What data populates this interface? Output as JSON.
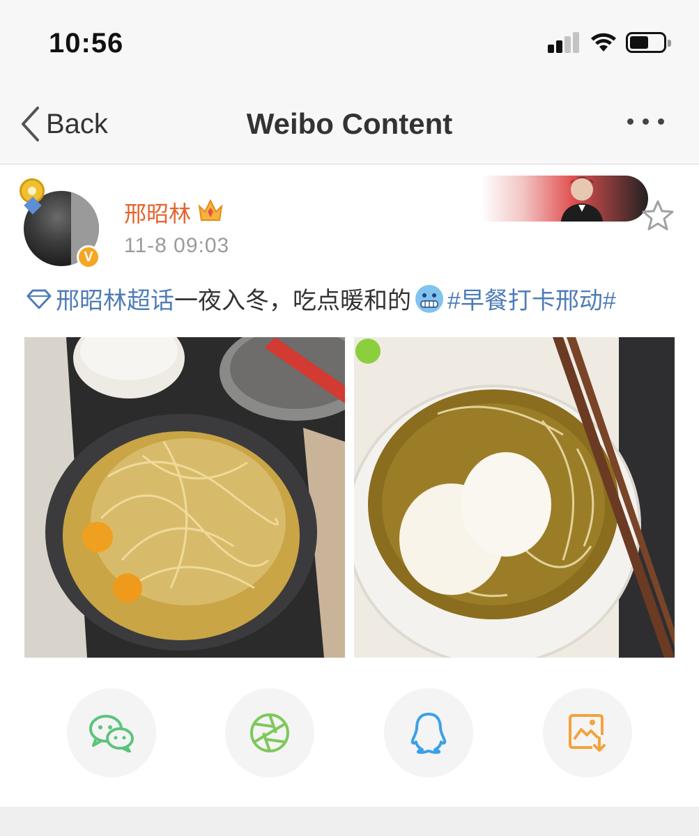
{
  "status_bar": {
    "time": "10:56"
  },
  "nav": {
    "back_label": "Back",
    "title": "Weibo Content"
  },
  "post": {
    "username": "邢昭林",
    "timestamp": "11-8 09:03",
    "supertopic": "邢昭林超话",
    "text": " 一夜入冬，吃点暖和的",
    "emoji": "freezing-face",
    "hashtag": "#早餐打卡邢动#",
    "verified_badge": "V",
    "photos": [
      {
        "name": "noodles-in-pan-photo"
      },
      {
        "name": "noodles-in-bowl-photo"
      }
    ]
  },
  "share": [
    {
      "name": "wechat-icon",
      "color": "#5cc47a"
    },
    {
      "name": "moments-icon",
      "color": "#7dc85a"
    },
    {
      "name": "qq-icon",
      "color": "#3aa0e8"
    },
    {
      "name": "save-image-icon",
      "color": "#f2a33a"
    }
  ],
  "colors": {
    "username": "#e2642c",
    "link": "#4f7cb8",
    "timestamp": "#9a9a9a"
  }
}
